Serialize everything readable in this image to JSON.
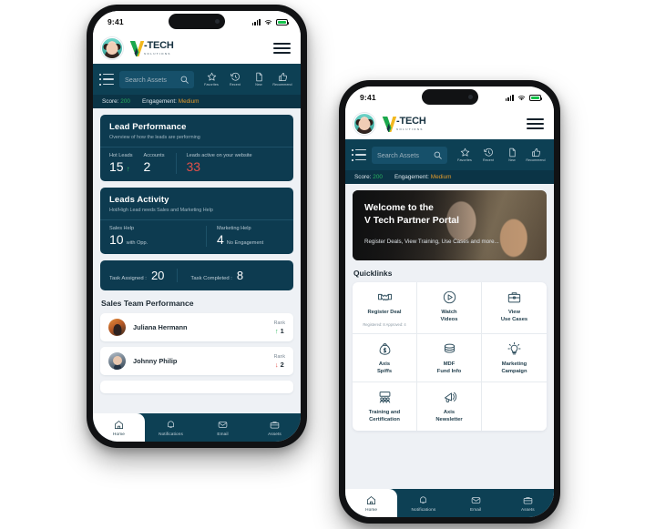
{
  "status": {
    "time": "9:41",
    "signal_icon": "cellular-signal-icon",
    "wifi_icon": "wifi-icon",
    "battery_icon": "battery-icon"
  },
  "brand": {
    "logo_main": "-TECH",
    "logo_sub": "SOLUTIONS",
    "logo_mark": "v-logo-mark",
    "avatar": "user-avatar"
  },
  "toolbar": {
    "menu_icon": "list-menu-icon",
    "search_placeholder": "Search Assets",
    "search_value": "",
    "search_icon": "search-icon",
    "items": [
      {
        "label": "Favorites",
        "icon": "star-icon"
      },
      {
        "label": "Recent",
        "icon": "history-clock-icon"
      },
      {
        "label": "New",
        "icon": "document-icon"
      },
      {
        "label": "Recommend",
        "icon": "thumbs-up-icon"
      }
    ]
  },
  "score_strip": {
    "score_label": "Score:",
    "score_value": "200",
    "engagement_label": "Engagement:",
    "engagement_value": "Medium",
    "score_color": "#28b15e",
    "engagement_color": "#e39a2b"
  },
  "phone1": {
    "lead_performance": {
      "title": "Lead Performance",
      "subtitle": "Overview of how the leads are performing",
      "metrics": [
        {
          "label": "Hot Leads",
          "value": "15",
          "trend": "up"
        },
        {
          "label": "Accounts",
          "value": "2",
          "trend": ""
        },
        {
          "label": "Leads active on your website",
          "value": "33",
          "trend": "",
          "highlight": "red"
        }
      ]
    },
    "leads_activity": {
      "title": "Leads Activity",
      "subtitle": "Hot/High Lead needs Sales and Marketing Help",
      "metrics": [
        {
          "label": "Sales Help",
          "value": "10",
          "unit": "with Opp."
        },
        {
          "label": "Marketing Help",
          "value": "4",
          "unit": "No Engagement"
        }
      ]
    },
    "tasks": [
      {
        "label": "Task Assigned :",
        "value": "20"
      },
      {
        "label": "Task Completed :",
        "value": "8"
      }
    ],
    "sales_team_title": "Sales Team Performance",
    "people": [
      {
        "name": "Juliana Hermann",
        "rank_label": "Rank",
        "rank": "1",
        "trend": "up",
        "avatar": "person-avatar-1"
      },
      {
        "name": "Johnny Philip",
        "rank_label": "Rank",
        "rank": "2",
        "trend": "down",
        "avatar": "person-avatar-2"
      }
    ]
  },
  "phone2": {
    "banner": {
      "heading_line1": "Welcome to the",
      "heading_line2": "V Tech Partner Portal",
      "subtext": "Register Deals, View Training, Use Cases and more..."
    },
    "quicklinks_title": "Quicklinks",
    "quicklinks": [
      {
        "label": "Register Deal",
        "note": "Registered: 8  Approved: 4",
        "icon": "handshake-icon"
      },
      {
        "label": "Watch\nVideos",
        "note": "",
        "icon": "play-circle-icon"
      },
      {
        "label": "View\nUse Cases",
        "note": "",
        "icon": "briefcase-icon"
      },
      {
        "label": "Axis\nSpiffs",
        "note": "",
        "icon": "money-bag-icon"
      },
      {
        "label": "MDF\nFund Info",
        "note": "",
        "icon": "coins-stack-icon"
      },
      {
        "label": "Marketing\nCampaign",
        "note": "",
        "icon": "lightbulb-idea-icon"
      },
      {
        "label": "Training and\nCertification",
        "note": "",
        "icon": "training-board-icon"
      },
      {
        "label": "Axis\nNewsletter",
        "note": "",
        "icon": "megaphone-icon"
      },
      {
        "label": "",
        "note": "",
        "icon": ""
      }
    ]
  },
  "bottom_nav": [
    {
      "label": "Home",
      "icon": "home-icon",
      "active": true
    },
    {
      "label": "Notifications",
      "icon": "bell-icon",
      "active": false
    },
    {
      "label": "Email",
      "icon": "envelope-icon",
      "active": false
    },
    {
      "label": "Assets",
      "icon": "briefcase-icon",
      "active": false
    }
  ],
  "theme": {
    "primary": "#0d4054",
    "card": "#0d3b50",
    "page_bg": "#eef1f5",
    "accent_green": "#28b15e",
    "accent_red": "#e2504a"
  }
}
